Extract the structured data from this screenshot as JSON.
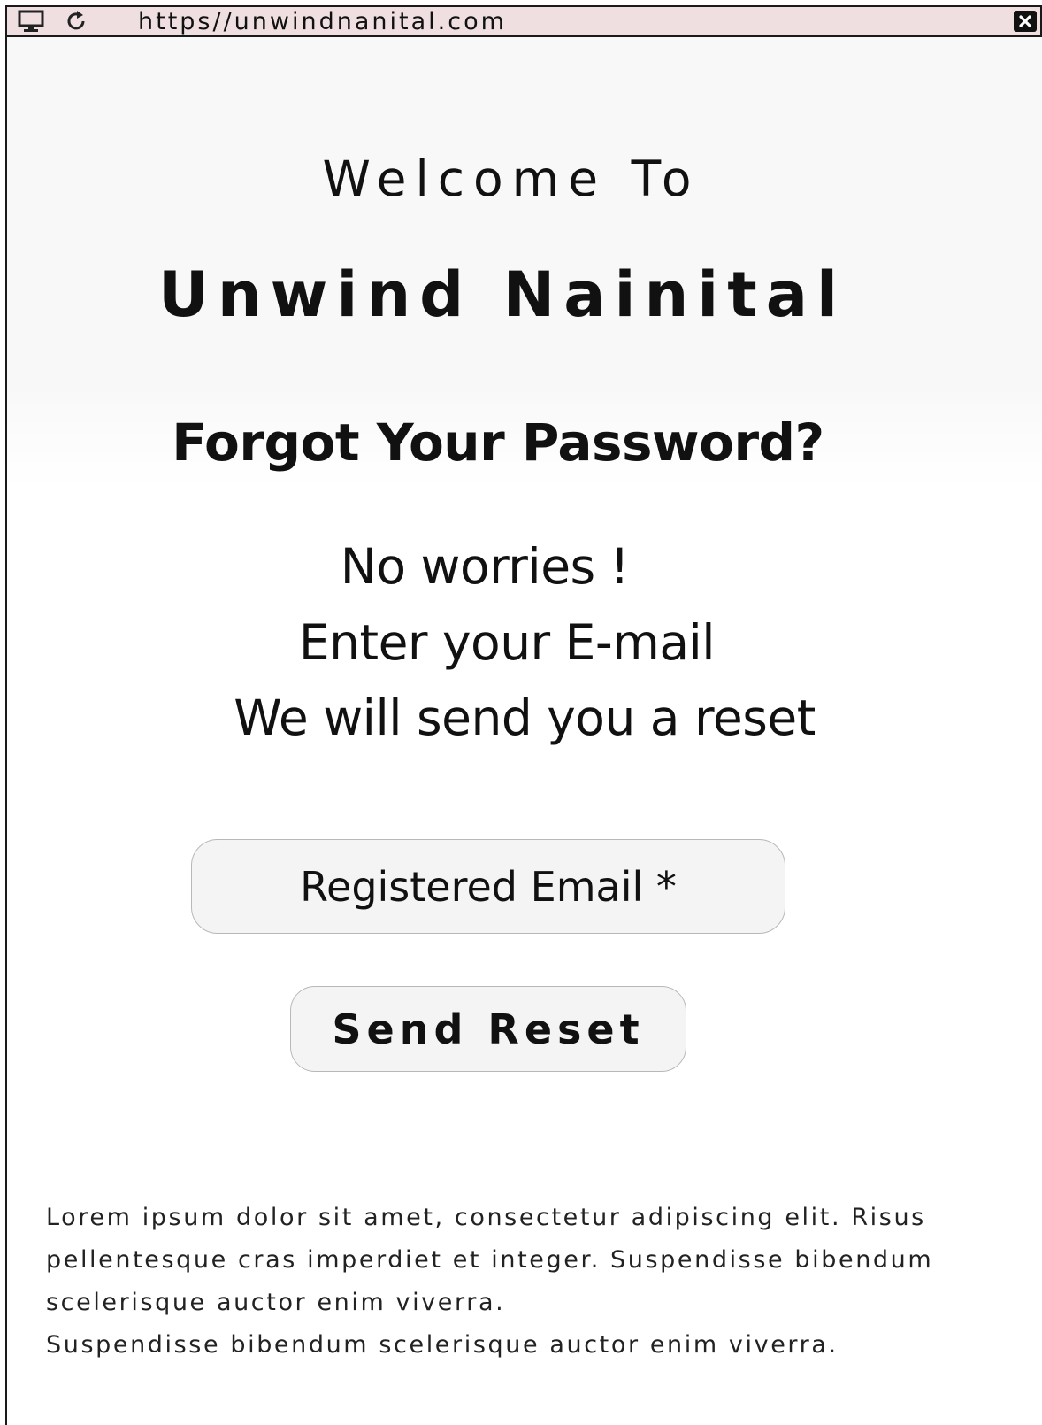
{
  "browser": {
    "url": "https//unwindnanital.com",
    "icons": [
      "monitor-icon",
      "reload-icon",
      "close-icon"
    ]
  },
  "page": {
    "welcome": "Welcome To",
    "brand": "Unwind Nainital",
    "heading": "Forgot Your Password?",
    "message_lines": [
      "No worries !",
      "Enter your E-mail",
      "We will send you a reset"
    ]
  },
  "form": {
    "email_placeholder": "Registered Email *",
    "submit_label": "Send Reset"
  },
  "footer": {
    "paragraph": "Lorem ipsum dolor sit amet, consectetur adipiscing elit. Risus pellentesque cras imperdiet et integer. Suspendisse bibendum scelerisque auctor enim viverra.",
    "line2": "Suspendisse bibendum scelerisque auctor enim viverra."
  },
  "colors": {
    "toolbar_bg": "#efdfe0",
    "field_bg": "#f4f4f4",
    "text": "#111111"
  }
}
